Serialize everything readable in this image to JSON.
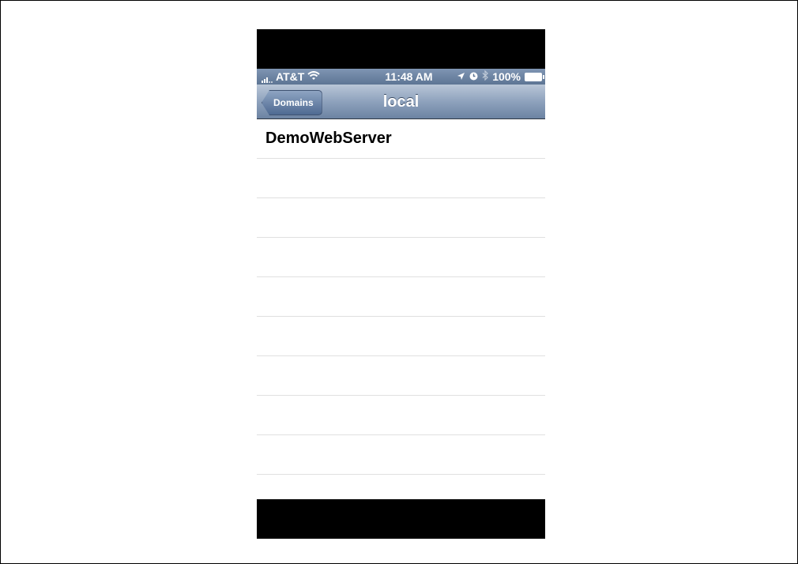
{
  "status_bar": {
    "carrier": "AT&T",
    "time": "11:48 AM",
    "battery": "100%",
    "icons": [
      "signal-icon",
      "wifi-icon",
      "location-icon",
      "alarm-icon",
      "bluetooth-icon",
      "battery-icon"
    ]
  },
  "nav": {
    "back_label": "Domains",
    "title": "local"
  },
  "list": {
    "items": [
      "DemoWebServer",
      "",
      "",
      "",
      "",
      "",
      "",
      "",
      ""
    ]
  }
}
